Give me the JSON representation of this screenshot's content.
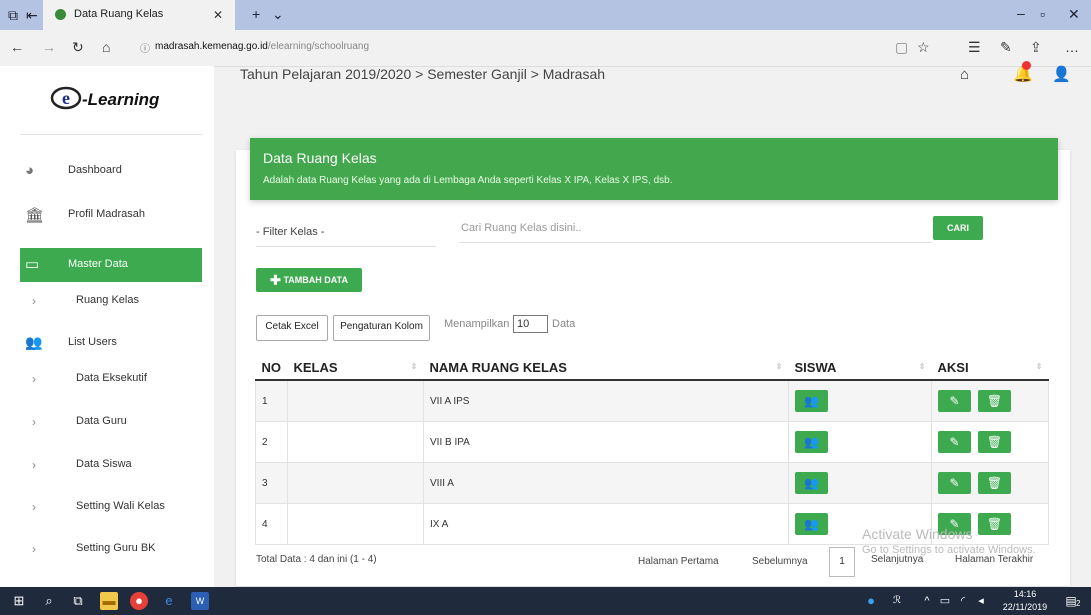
{
  "browser": {
    "tab_title": "Data Ruang Kelas",
    "url_domain": "madrasah.kemenag.go.id",
    "url_path": "/elearning/schoolruang"
  },
  "logo": {
    "text": "-Learning"
  },
  "breadcrumb": "Tahun Pelajaran 2019/2020 > Semester Ganjil > Madrasah",
  "sidebar": {
    "items": [
      {
        "label": "Dashboard"
      },
      {
        "label": "Profil Madrasah"
      },
      {
        "label": "Master Data"
      },
      {
        "label": "Ruang Kelas"
      },
      {
        "label": "List Users"
      },
      {
        "label": "Data Eksekutif"
      },
      {
        "label": "Data Guru"
      },
      {
        "label": "Data Siswa"
      },
      {
        "label": "Setting Wali Kelas"
      },
      {
        "label": "Setting Guru BK"
      }
    ]
  },
  "banner": {
    "title": "Data Ruang Kelas",
    "subtitle": "Adalah data Ruang Kelas yang ada di Lembaga Anda seperti Kelas X IPA, Kelas X IPS, dsb."
  },
  "filter": {
    "kelas_placeholder": "- Filter Kelas -",
    "search_placeholder": "Cari  Ruang Kelas disini..",
    "search_button": "CARI"
  },
  "actions": {
    "add_button": "TAMBAH DATA",
    "excel_button": "Cetak Excel",
    "columns_button": "Pengaturan Kolom",
    "show_prefix": "Menampilkan",
    "show_value": "10",
    "show_suffix": "Data"
  },
  "table": {
    "headers": [
      "NO",
      "KELAS",
      "NAMA RUANG KELAS",
      "SISWA",
      "AKSI"
    ],
    "rows": [
      {
        "no": "1",
        "kelas": "",
        "nama": "VII A IPS"
      },
      {
        "no": "2",
        "kelas": "",
        "nama": "VII B IPA"
      },
      {
        "no": "3",
        "kelas": "",
        "nama": "VIII A"
      },
      {
        "no": "4",
        "kelas": "",
        "nama": "IX A"
      }
    ]
  },
  "footer": {
    "total": "Total Data : 4 dan ini (1 - 4)",
    "first": "Halaman Pertama",
    "prev": "Sebelumnya",
    "page": "1",
    "next": "Selanjutnya",
    "last": "Halaman Terakhir"
  },
  "watermark": {
    "line1": "Activate Windows",
    "line2": "Go to Settings to activate Windows."
  },
  "taskbar": {
    "time": "14:16",
    "date": "22/11/2019",
    "notif_count": "2"
  },
  "colors": {
    "accent": "#3daa4f",
    "banner": "#43a84d",
    "taskbar": "#1f2a3c"
  }
}
